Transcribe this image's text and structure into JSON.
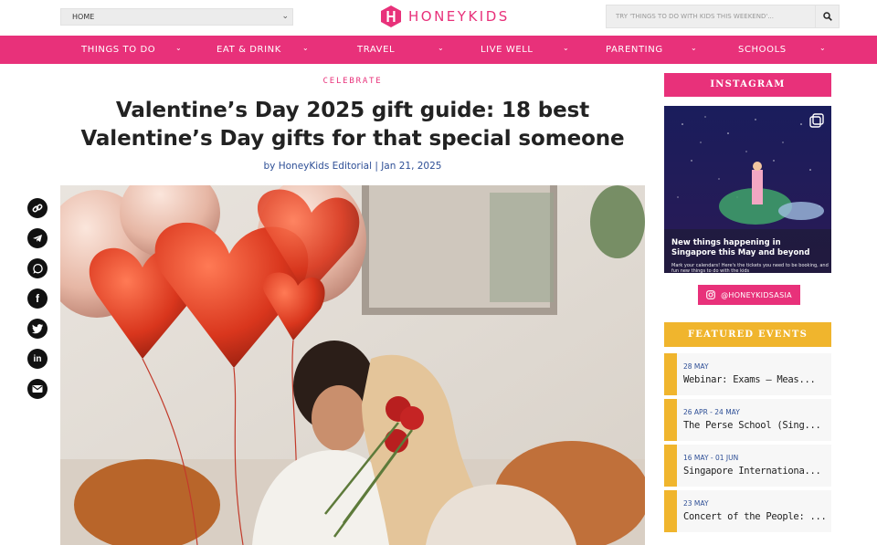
{
  "topbar": {
    "home_select": "HOME",
    "logo_text": "HONEYKIDS",
    "search_placeholder": "TRY 'THINGS TO DO WITH KIDS THIS WEEKEND'..."
  },
  "nav": {
    "items": [
      {
        "label": "THINGS TO DO"
      },
      {
        "label": "EAT & DRINK"
      },
      {
        "label": "TRAVEL"
      },
      {
        "label": "LIVE WELL"
      },
      {
        "label": "PARENTING"
      },
      {
        "label": "SCHOOLS"
      }
    ]
  },
  "article": {
    "kicker": "CELEBRATE",
    "title": "Valentine’s Day 2025 gift guide: 18 best Valentine’s Day gifts for that special someone",
    "byline": "by HoneyKids Editorial | Jan 21, 2025"
  },
  "share": {
    "icons": [
      "link-icon",
      "telegram-icon",
      "whatsapp-icon",
      "facebook-icon",
      "twitter-icon",
      "linkedin-icon",
      "email-icon"
    ]
  },
  "sidebar": {
    "instagram_heading": "INSTAGRAM",
    "instagram_post_title": "New things happening in Singapore this May and beyond",
    "instagram_post_sub": "Mark your calendars! Here's the tickets you need to be booking, and fun new things to do with the kids",
    "instagram_handle": "@HONEYKIDSASIA",
    "featured_heading": "FEATURED EVENTS",
    "events": [
      {
        "date": "28 MAY",
        "title": "Webinar: Exams – Meas..."
      },
      {
        "date": "26 APR - 24 MAY",
        "title": "The Perse School (Sing..."
      },
      {
        "date": "16 MAY - 01 JUN",
        "title": "Singapore Internationa..."
      },
      {
        "date": "23 MAY",
        "title": "Concert of the People: ..."
      }
    ]
  },
  "colors": {
    "brand_pink": "#e8317a",
    "featured_gold": "#f0b52d",
    "link_blue": "#2e4f96"
  }
}
